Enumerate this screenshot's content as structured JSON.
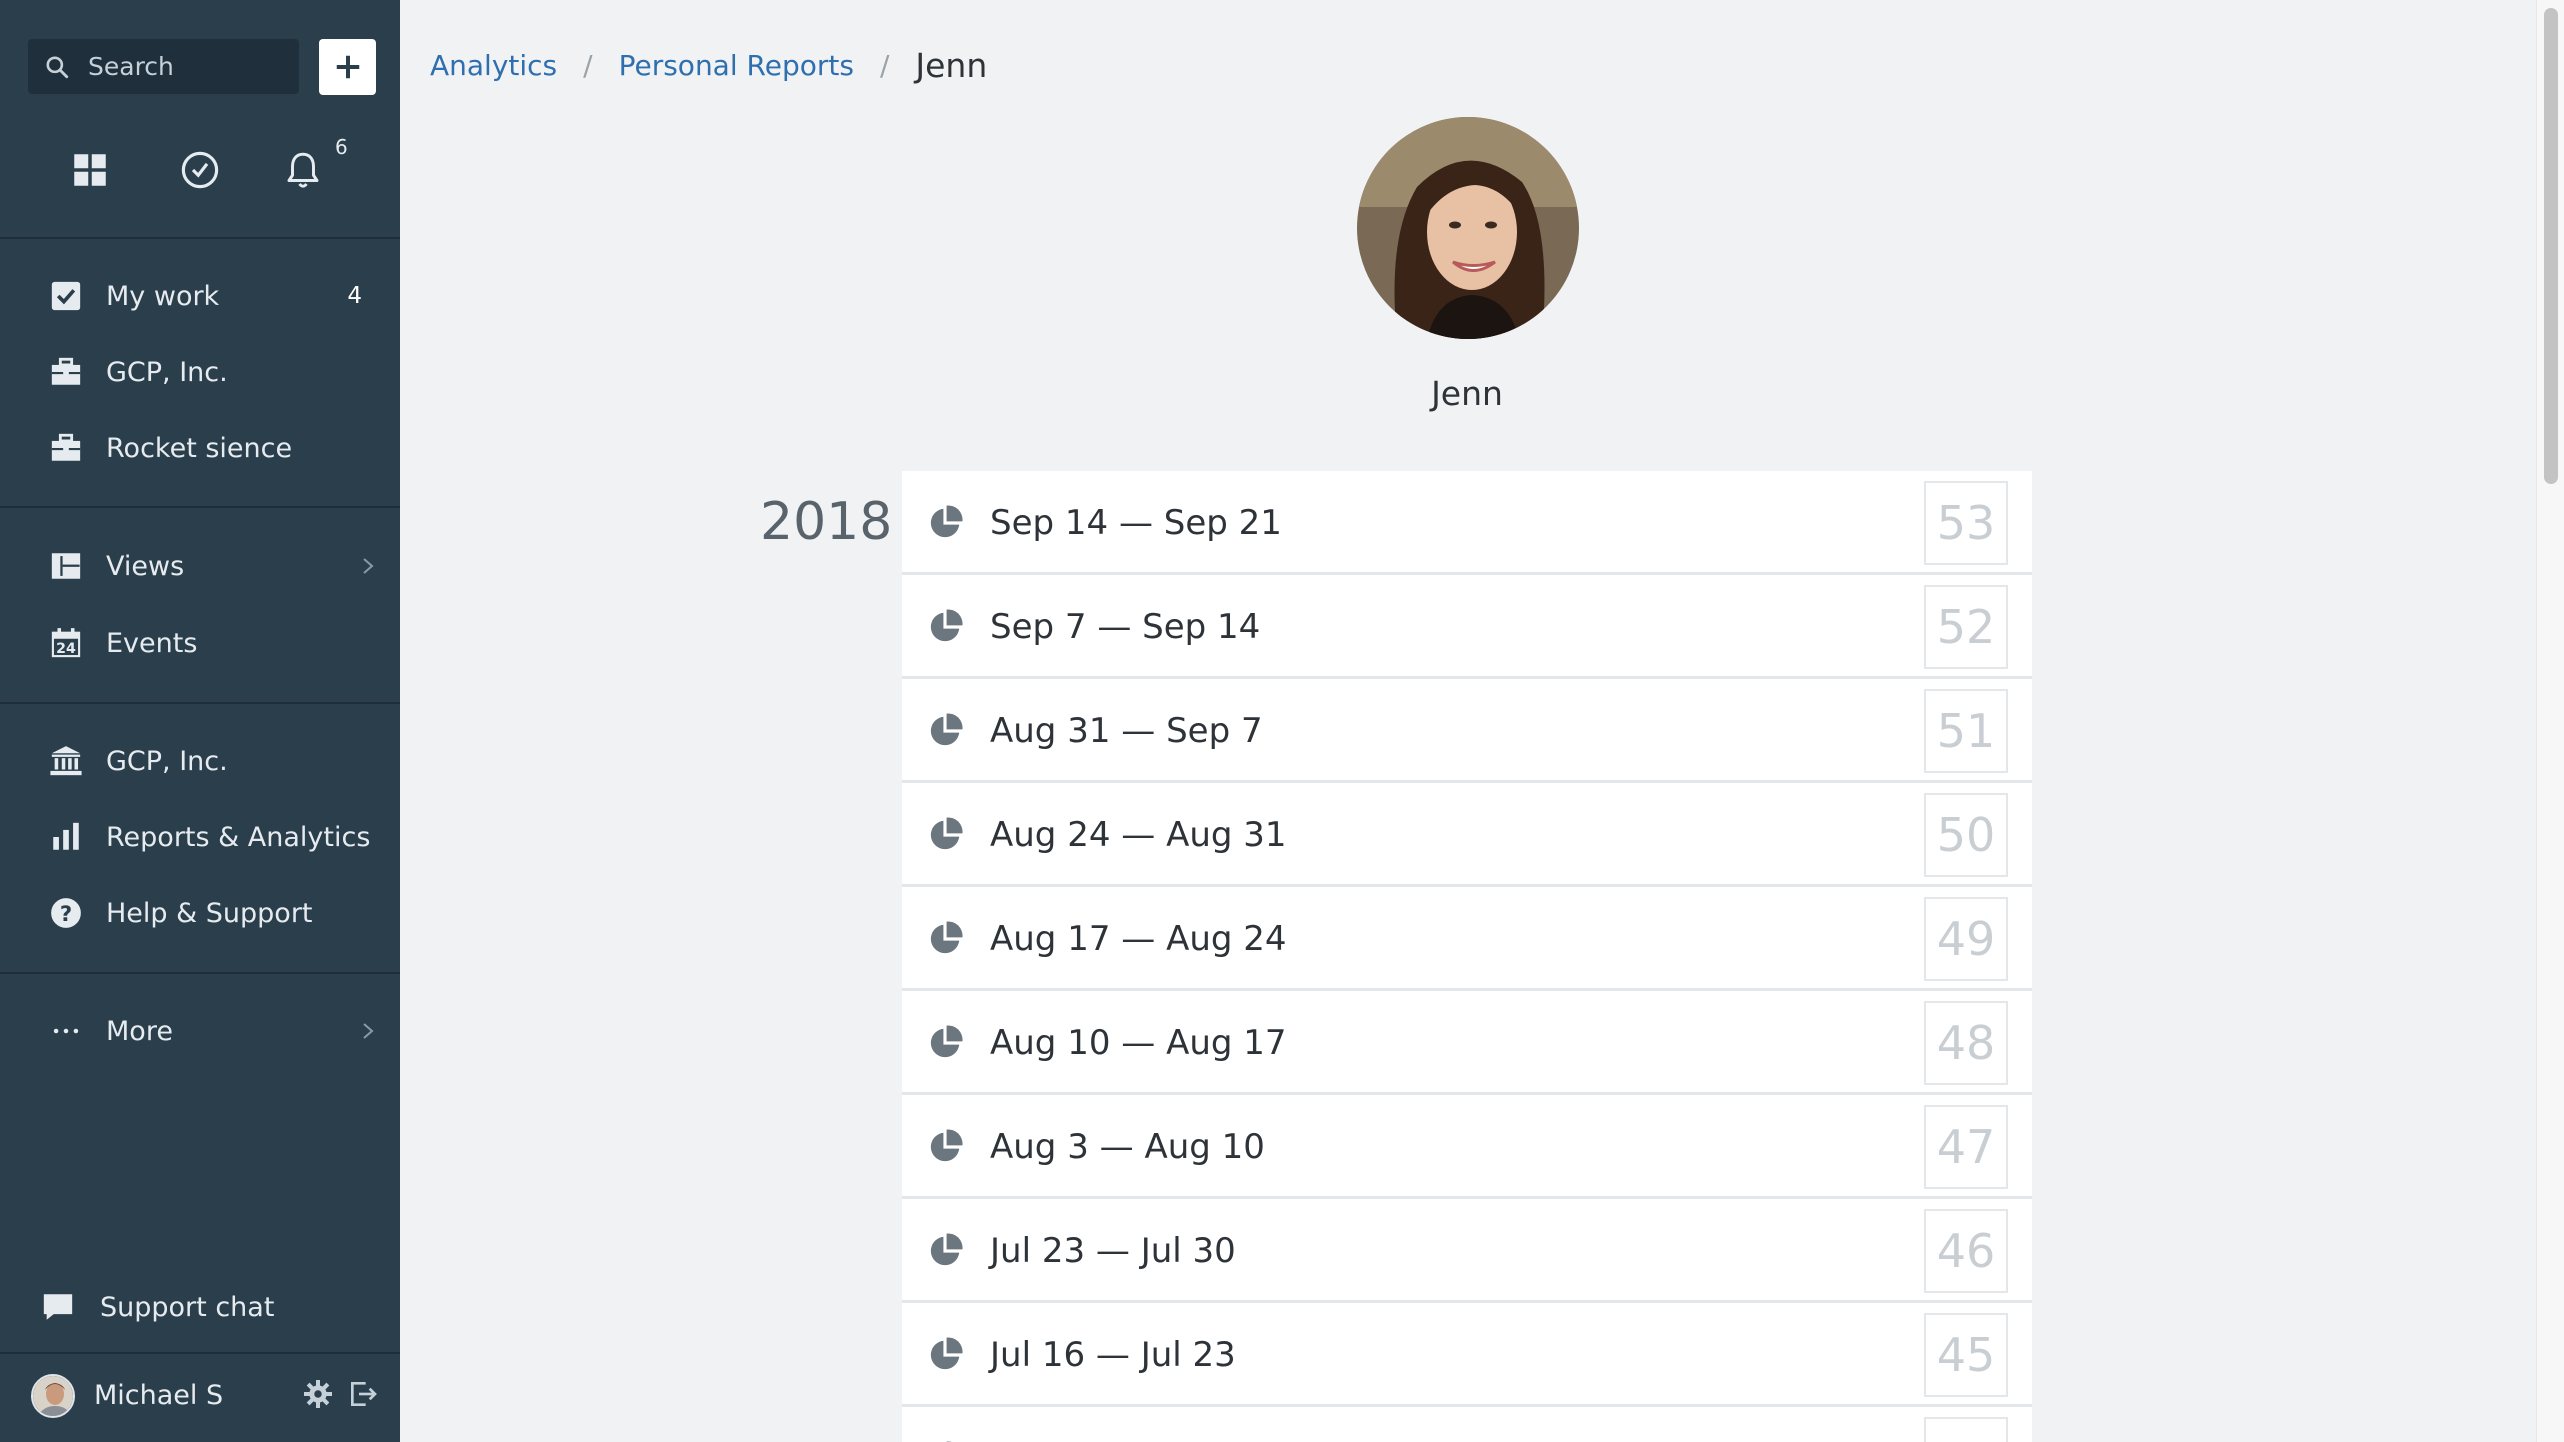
{
  "sidebar": {
    "search": {
      "placeholder": "Search"
    },
    "add_button_icon": "plus-icon",
    "quick_icons": [
      "grid-icon",
      "clock-icon",
      "bell-icon"
    ],
    "notification_count": "6",
    "primary_nav": [
      {
        "label": "My work",
        "icon": "checkbox-icon",
        "count": "4"
      },
      {
        "label": "GCP, Inc.",
        "icon": "briefcase-icon"
      },
      {
        "label": "Rocket sience",
        "icon": "briefcase-icon"
      }
    ],
    "secondary_nav": [
      {
        "label": "Views",
        "icon": "views-icon",
        "has_submenu": true
      },
      {
        "label": "Events",
        "icon": "calendar-icon"
      }
    ],
    "tertiary_nav": [
      {
        "label": "GCP, Inc.",
        "icon": "bank-icon"
      },
      {
        "label": "Reports & Analytics",
        "icon": "bar-chart-icon"
      },
      {
        "label": "Help & Support",
        "icon": "question-icon"
      }
    ],
    "more": {
      "label": "More",
      "icon": "ellipsis-icon",
      "has_submenu": true
    },
    "support_chat": {
      "label": "Support chat",
      "icon": "chat-icon"
    },
    "user": {
      "name": "Michael S"
    }
  },
  "breadcrumb": {
    "items": [
      "Analytics",
      "Personal Reports"
    ],
    "separator": "/",
    "current": "Jenn"
  },
  "profile": {
    "name": "Jenn"
  },
  "reports": {
    "year": "2018",
    "rows": [
      {
        "range": "Sep 14 — Sep 21",
        "week": "53"
      },
      {
        "range": "Sep 7 — Sep 14",
        "week": "52"
      },
      {
        "range": "Aug 31 — Sep 7",
        "week": "51"
      },
      {
        "range": "Aug 24 — Aug 31",
        "week": "50"
      },
      {
        "range": "Aug 17 — Aug 24",
        "week": "49"
      },
      {
        "range": "Aug 10 — Aug 17",
        "week": "48"
      },
      {
        "range": "Aug 3 — Aug 10",
        "week": "47"
      },
      {
        "range": "Jul 23 — Jul 30",
        "week": "46"
      },
      {
        "range": "Jul 16 — Jul 23",
        "week": "45"
      },
      {
        "range": "",
        "week": ""
      }
    ]
  },
  "colors": {
    "sidebar_bg": "#2b3e4c",
    "link": "#2f6fb0",
    "page_bg": "#f1f2f4"
  }
}
